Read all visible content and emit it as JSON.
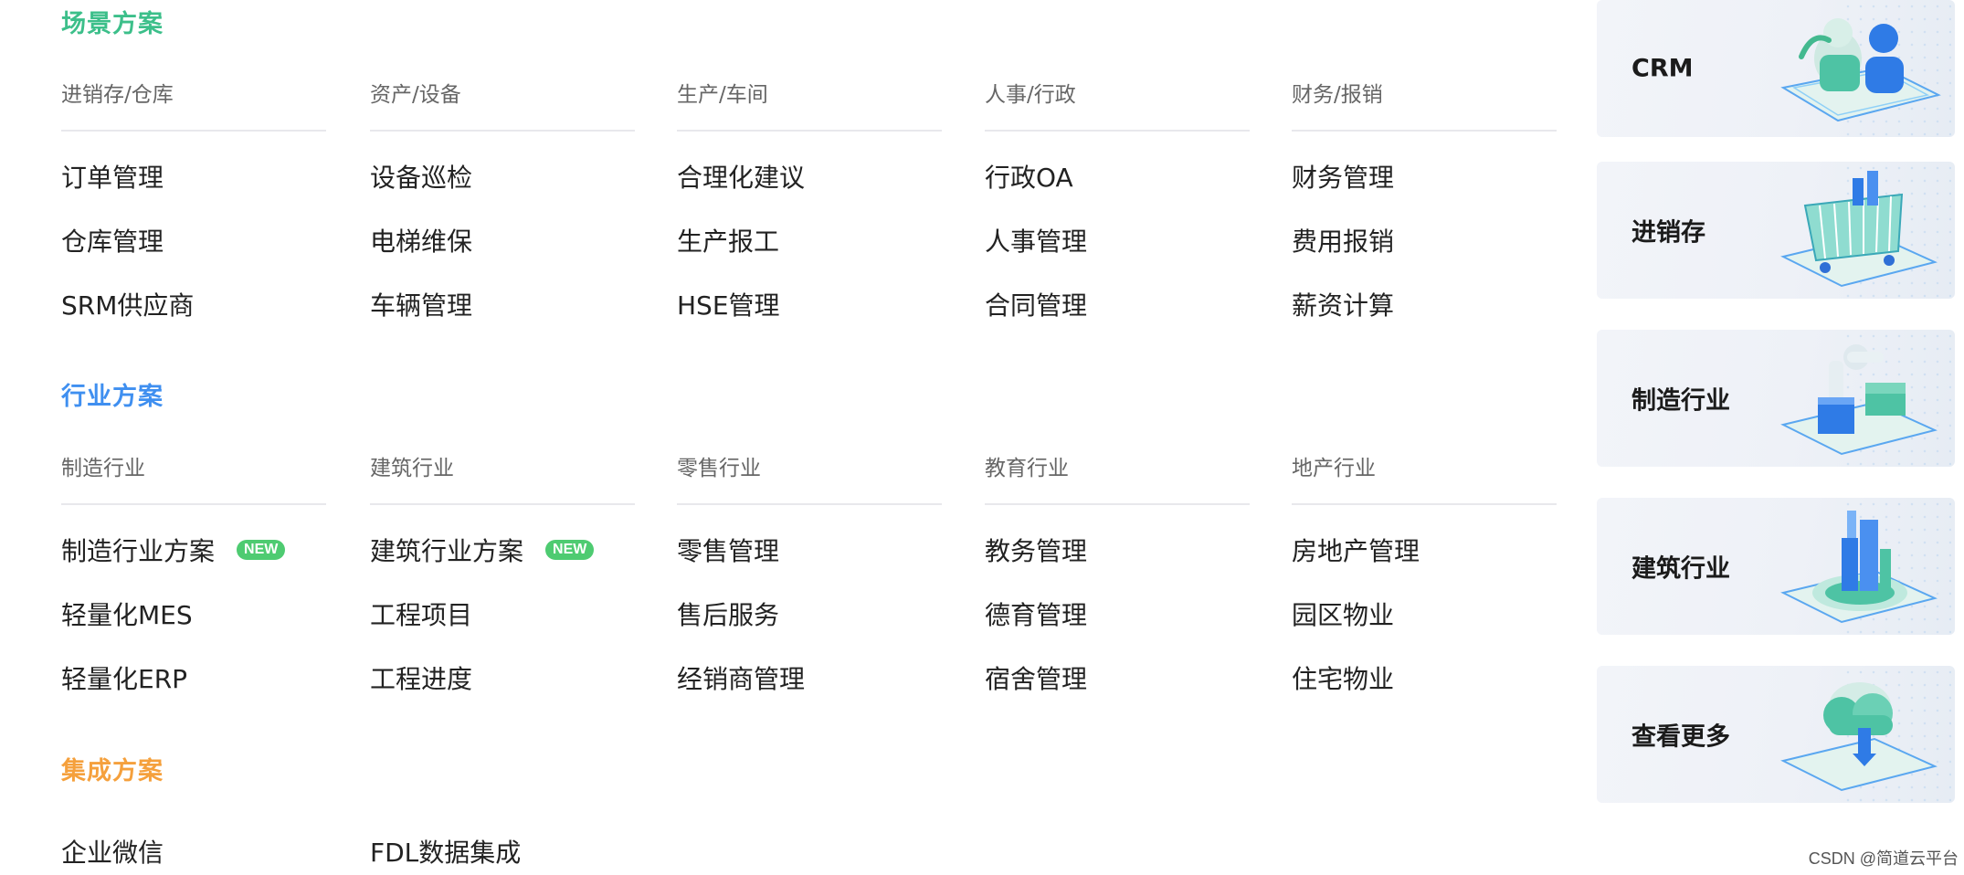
{
  "sections": [
    {
      "title": "场景方案",
      "color": "#3cbf8a",
      "columns": [
        {
          "header": "进销存/仓库",
          "items": [
            {
              "label": "订单管理"
            },
            {
              "label": "仓库管理"
            },
            {
              "label": "SRM供应商"
            }
          ]
        },
        {
          "header": "资产/设备",
          "items": [
            {
              "label": "设备巡检"
            },
            {
              "label": "电梯维保"
            },
            {
              "label": "车辆管理"
            }
          ]
        },
        {
          "header": "生产/车间",
          "items": [
            {
              "label": "合理化建议"
            },
            {
              "label": "生产报工"
            },
            {
              "label": "HSE管理"
            }
          ]
        },
        {
          "header": "人事/行政",
          "items": [
            {
              "label": "行政OA"
            },
            {
              "label": "人事管理"
            },
            {
              "label": "合同管理"
            }
          ]
        },
        {
          "header": "财务/报销",
          "items": [
            {
              "label": "财务管理"
            },
            {
              "label": "费用报销"
            },
            {
              "label": "薪资计算"
            }
          ]
        }
      ]
    },
    {
      "title": "行业方案",
      "color": "#3f8ff0",
      "columns": [
        {
          "header": "制造行业",
          "items": [
            {
              "label": "制造行业方案",
              "badge": "NEW"
            },
            {
              "label": "轻量化MES"
            },
            {
              "label": "轻量化ERP"
            }
          ]
        },
        {
          "header": "建筑行业",
          "items": [
            {
              "label": "建筑行业方案",
              "badge": "NEW"
            },
            {
              "label": "工程项目"
            },
            {
              "label": "工程进度"
            }
          ]
        },
        {
          "header": "零售行业",
          "items": [
            {
              "label": "零售管理"
            },
            {
              "label": "售后服务"
            },
            {
              "label": "经销商管理"
            }
          ]
        },
        {
          "header": "教育行业",
          "items": [
            {
              "label": "教务管理"
            },
            {
              "label": "德育管理"
            },
            {
              "label": "宿舍管理"
            }
          ]
        },
        {
          "header": "地产行业",
          "items": [
            {
              "label": "房地产管理"
            },
            {
              "label": "园区物业"
            },
            {
              "label": "住宅物业"
            }
          ]
        }
      ]
    },
    {
      "title": "集成方案",
      "color": "#f5a03c",
      "columns": [
        {
          "header": "",
          "items": [
            {
              "label": "企业微信"
            }
          ]
        },
        {
          "header": "",
          "items": [
            {
              "label": "FDL数据集成"
            }
          ]
        }
      ]
    }
  ],
  "cards": [
    {
      "label": "CRM",
      "icon": "crm-people-icon"
    },
    {
      "label": "进销存",
      "icon": "shopping-cart-icon"
    },
    {
      "label": "制造行业",
      "icon": "robot-arm-icon"
    },
    {
      "label": "建筑行业",
      "icon": "building-icon"
    },
    {
      "label": "查看更多",
      "icon": "cloud-icon"
    }
  ],
  "watermark": "CSDN @简道云平台"
}
